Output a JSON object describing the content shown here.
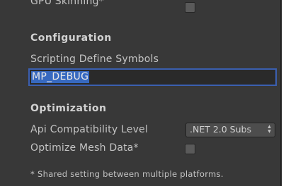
{
  "rows": {
    "gpu_skinning_label": "GPU Skinning*",
    "configuration_header": "Configuration",
    "scripting_symbols_label": "Scripting Define Symbols",
    "scripting_symbols_value": "MP_DEBUG",
    "optimization_header": "Optimization",
    "api_level_label": "Api Compatibility Level",
    "api_level_value": ".NET 2.0 Subs",
    "optimize_mesh_label": "Optimize Mesh Data*",
    "footnote": "* Shared setting between multiple platforms."
  },
  "checkboxes": {
    "gpu_skinning_checked": false,
    "optimize_mesh_checked": false
  },
  "icons": {
    "dropdown_arrow": "updown-arrow-icon"
  }
}
